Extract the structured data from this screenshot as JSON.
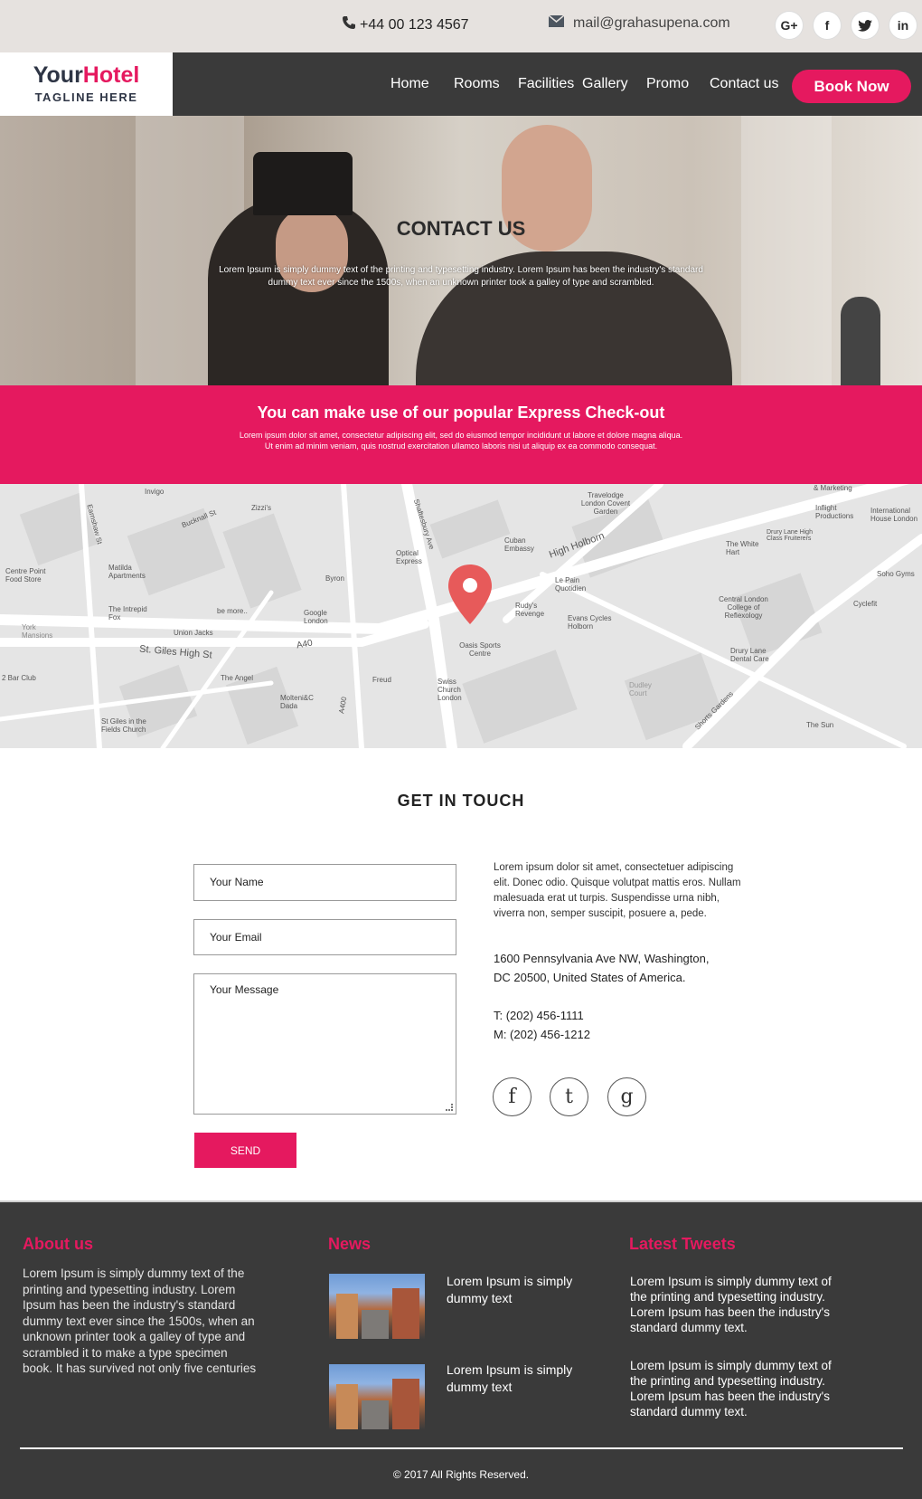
{
  "topbar": {
    "phone": "+44 00 123 4567",
    "email": "mail@grahasupena.com",
    "social": [
      "G+",
      "f",
      "t",
      "in"
    ]
  },
  "nav": {
    "logo_your": "Your",
    "logo_hotel": "Hotel",
    "tagline": "TAGLINE HERE",
    "items": [
      "Home",
      "Rooms",
      "Facilities",
      "Gallery",
      "Promo",
      "Contact us"
    ],
    "book_label": "Book Now"
  },
  "hero": {
    "title": "CONTACT US",
    "text": "Lorem Ipsum is simply dummy text of the printing and typesetting industry. Lorem Ipsum has been the industry's standard dummy text ever since the 1500s, when an unknown printer took a galley of type and scrambled."
  },
  "express": {
    "title": "You can make use of our popular Express Check-out",
    "text": "Lorem ipsum dolor sit amet, consectetur adipiscing elit, sed do eiusmod tempor incididunt ut labore et dolore magna aliqua. Ut enim ad minim veniam, quis nostrud exercitation ullamco laboris nisi ut aliquip ex ea commodo consequat."
  },
  "map": {
    "labels": [
      "Invigo",
      "Zizzi's",
      "Bucknall St",
      "Earnshaw St",
      "Shaftesbury Ave",
      "Travelodge London Covent Garden",
      "Inflight Productions",
      "International House London",
      "Centre Point Food Store",
      "Matilda Apartments",
      "Optical Express",
      "Cuban Embassy",
      "High Holborn",
      "The White Hart",
      "Drury Lane High Class Fruiterers",
      "Soho Gyms",
      "Byron",
      "Le Pain Quotidien",
      "Central London College of Reflexology",
      "Cyclefit",
      "The Intrepid Fox",
      "be more..",
      "Google London",
      "Rudy's Revenge",
      "Evans Cycles Holborn",
      "York Mansions",
      "Union Jacks",
      "St. Giles High St",
      "A40",
      "Oasis Sports Centre",
      "Drury Lane Dental Care",
      "2 Bar Club",
      "The Angel",
      "Freud",
      "Swiss Church London",
      "Dudley Court",
      "Molteni&C Dada",
      "A400",
      "St Giles in the Fields Church",
      "The Sun",
      "Shorts Gardens",
      "& Marketing"
    ]
  },
  "contact": {
    "heading": "GET IN TOUCH",
    "name_placeholder": "Your Name",
    "email_placeholder": "Your Email",
    "message_placeholder": "Your Message",
    "send_label": "SEND",
    "intro": "Lorem ipsum dolor sit amet, consectetuer adipiscing elit. Donec odio. Quisque volutpat mattis eros. Nullam malesuada erat ut turpis. Suspendisse urna nibh, viverra non, semper suscipit, posuere a, pede.",
    "address_line1": "1600 Pennsylvania Ave NW, Washington,",
    "address_line2": "DC 20500, United States of America.",
    "tel": "T: (202) 456-1111",
    "mobile": "M: (202) 456-1212",
    "social": [
      "f",
      "t",
      "g"
    ]
  },
  "footer": {
    "about_title": "About us",
    "about_text": "Lorem Ipsum is simply dummy text of the printing and typesetting industry. Lorem Ipsum has been the industry's standard dummy text ever since the 1500s, when an unknown printer took a galley of type and scrambled it to make a type specimen book. It has survived not only five centuries",
    "news_title": "News",
    "news": [
      "Lorem Ipsum is simply dummy text",
      "Lorem Ipsum is simply dummy text"
    ],
    "tweets_title": "Latest Tweets",
    "tweets": [
      "Lorem Ipsum is simply dummy text of the printing and typesetting industry. Lorem Ipsum has been the industry's standard dummy text.",
      "Lorem Ipsum is simply dummy text of the printing and typesetting industry. Lorem Ipsum has been the industry's standard dummy text."
    ],
    "copyright": "© 2017 All Rights Reserved."
  },
  "colors": {
    "accent": "#e5195f",
    "dark": "#3a3a3a",
    "topbar": "#e6e2df"
  }
}
